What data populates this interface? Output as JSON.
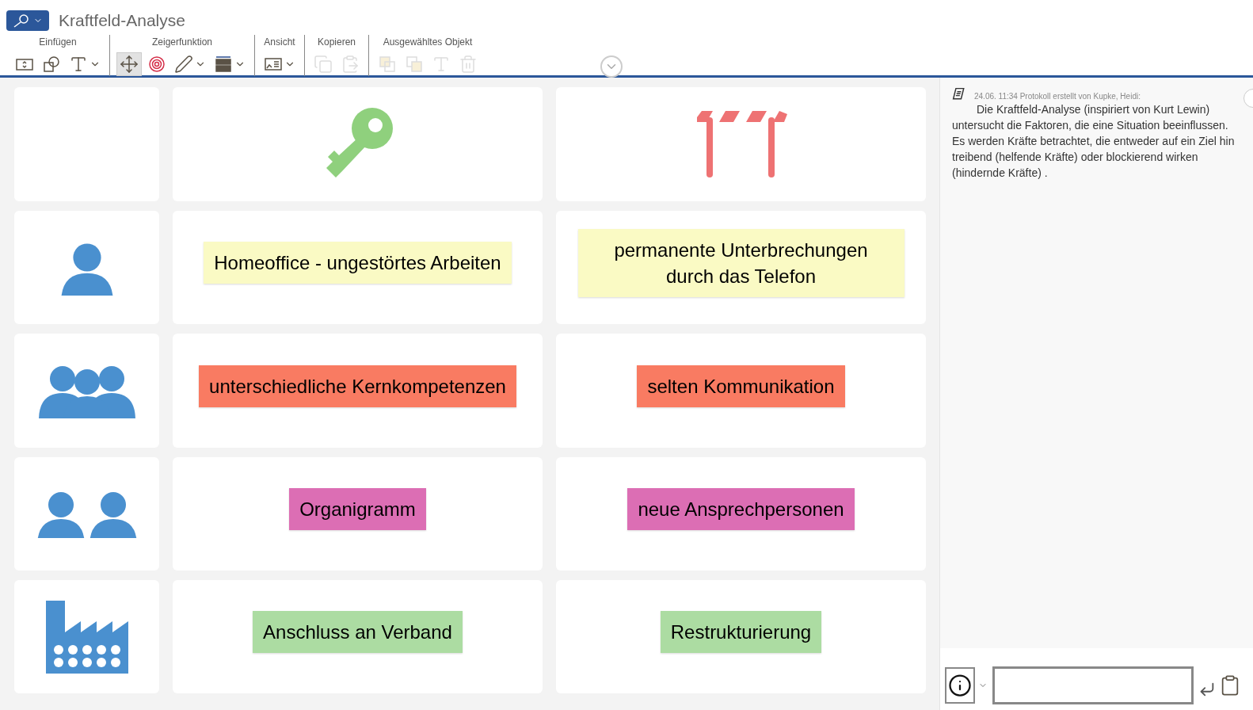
{
  "window": {
    "title": "Kraftfeld-Analyse"
  },
  "toolbar": [
    {
      "label": "Einfügen",
      "tools": [
        {
          "kind": "frame",
          "selected": false,
          "disabled": false,
          "menu": false
        },
        {
          "kind": "shapes",
          "selected": false,
          "disabled": false,
          "menu": false
        },
        {
          "kind": "text",
          "selected": false,
          "disabled": false,
          "menu": true
        }
      ]
    },
    {
      "label": "Zeigerfunktion",
      "tools": [
        {
          "kind": "move",
          "selected": true,
          "disabled": false,
          "menu": false
        },
        {
          "kind": "target",
          "selected": false,
          "disabled": false,
          "menu": false
        },
        {
          "kind": "pen",
          "selected": false,
          "disabled": false,
          "menu": true
        },
        {
          "kind": "lines",
          "selected": false,
          "disabled": false,
          "menu": true
        }
      ]
    },
    {
      "label": "Ansicht",
      "tools": [
        {
          "kind": "view",
          "selected": false,
          "disabled": false,
          "menu": true
        }
      ]
    },
    {
      "label": "Kopieren",
      "tools": [
        {
          "kind": "copy",
          "selected": false,
          "disabled": true,
          "menu": false
        },
        {
          "kind": "paste",
          "selected": false,
          "disabled": true,
          "menu": false
        }
      ]
    },
    {
      "label": "Ausgewähltes Objekt",
      "tools": [
        {
          "kind": "front",
          "selected": false,
          "disabled": true,
          "menu": false
        },
        {
          "kind": "back",
          "selected": false,
          "disabled": true,
          "menu": false
        },
        {
          "kind": "text",
          "selected": false,
          "disabled": true,
          "menu": false
        },
        {
          "kind": "delete",
          "selected": false,
          "disabled": true,
          "menu": false
        }
      ]
    }
  ],
  "board": {
    "columns": [
      {
        "kind": "key"
      },
      {
        "kind": "barrier"
      }
    ],
    "rows": [
      {
        "kind": "person",
        "notes": [
          {
            "text": "Homeoffice - ungestörtes Arbeiten",
            "color": "#fafac4"
          },
          {
            "text": "permanente Unterbrechungen durch das Telefon",
            "color": "#fafac4"
          }
        ]
      },
      {
        "kind": "group",
        "notes": [
          {
            "text": "unterschiedliche Kernkompetenzen",
            "color": "#f97b62"
          },
          {
            "text": "selten Kommunikation",
            "color": "#f97b62"
          }
        ]
      },
      {
        "kind": "pair",
        "notes": [
          {
            "text": "Organigramm",
            "color": "#dc6eb4"
          },
          {
            "text": "neue Ansprechpersonen",
            "color": "#dc6eb4"
          }
        ]
      },
      {
        "kind": "factory",
        "notes": [
          {
            "text": "Anschluss an Verband",
            "color": "#acdca2"
          },
          {
            "text": "Restrukturierung",
            "color": "#acdca2"
          }
        ]
      }
    ]
  },
  "protocol": {
    "meta": "24.06. 11:34 Protokoll erstellt von Kupke, Heidi:",
    "text": "Die Kraftfeld-Analyse (inspiriert von Kurt Lewin) untersucht die Faktoren, die eine Situation beeinflussen. Es werden Kräfte betrachtet, die entweder auf ein Ziel hin treibend (helfende Kräfte) oder blockierend wirken (hindernde Kräfte) ."
  }
}
